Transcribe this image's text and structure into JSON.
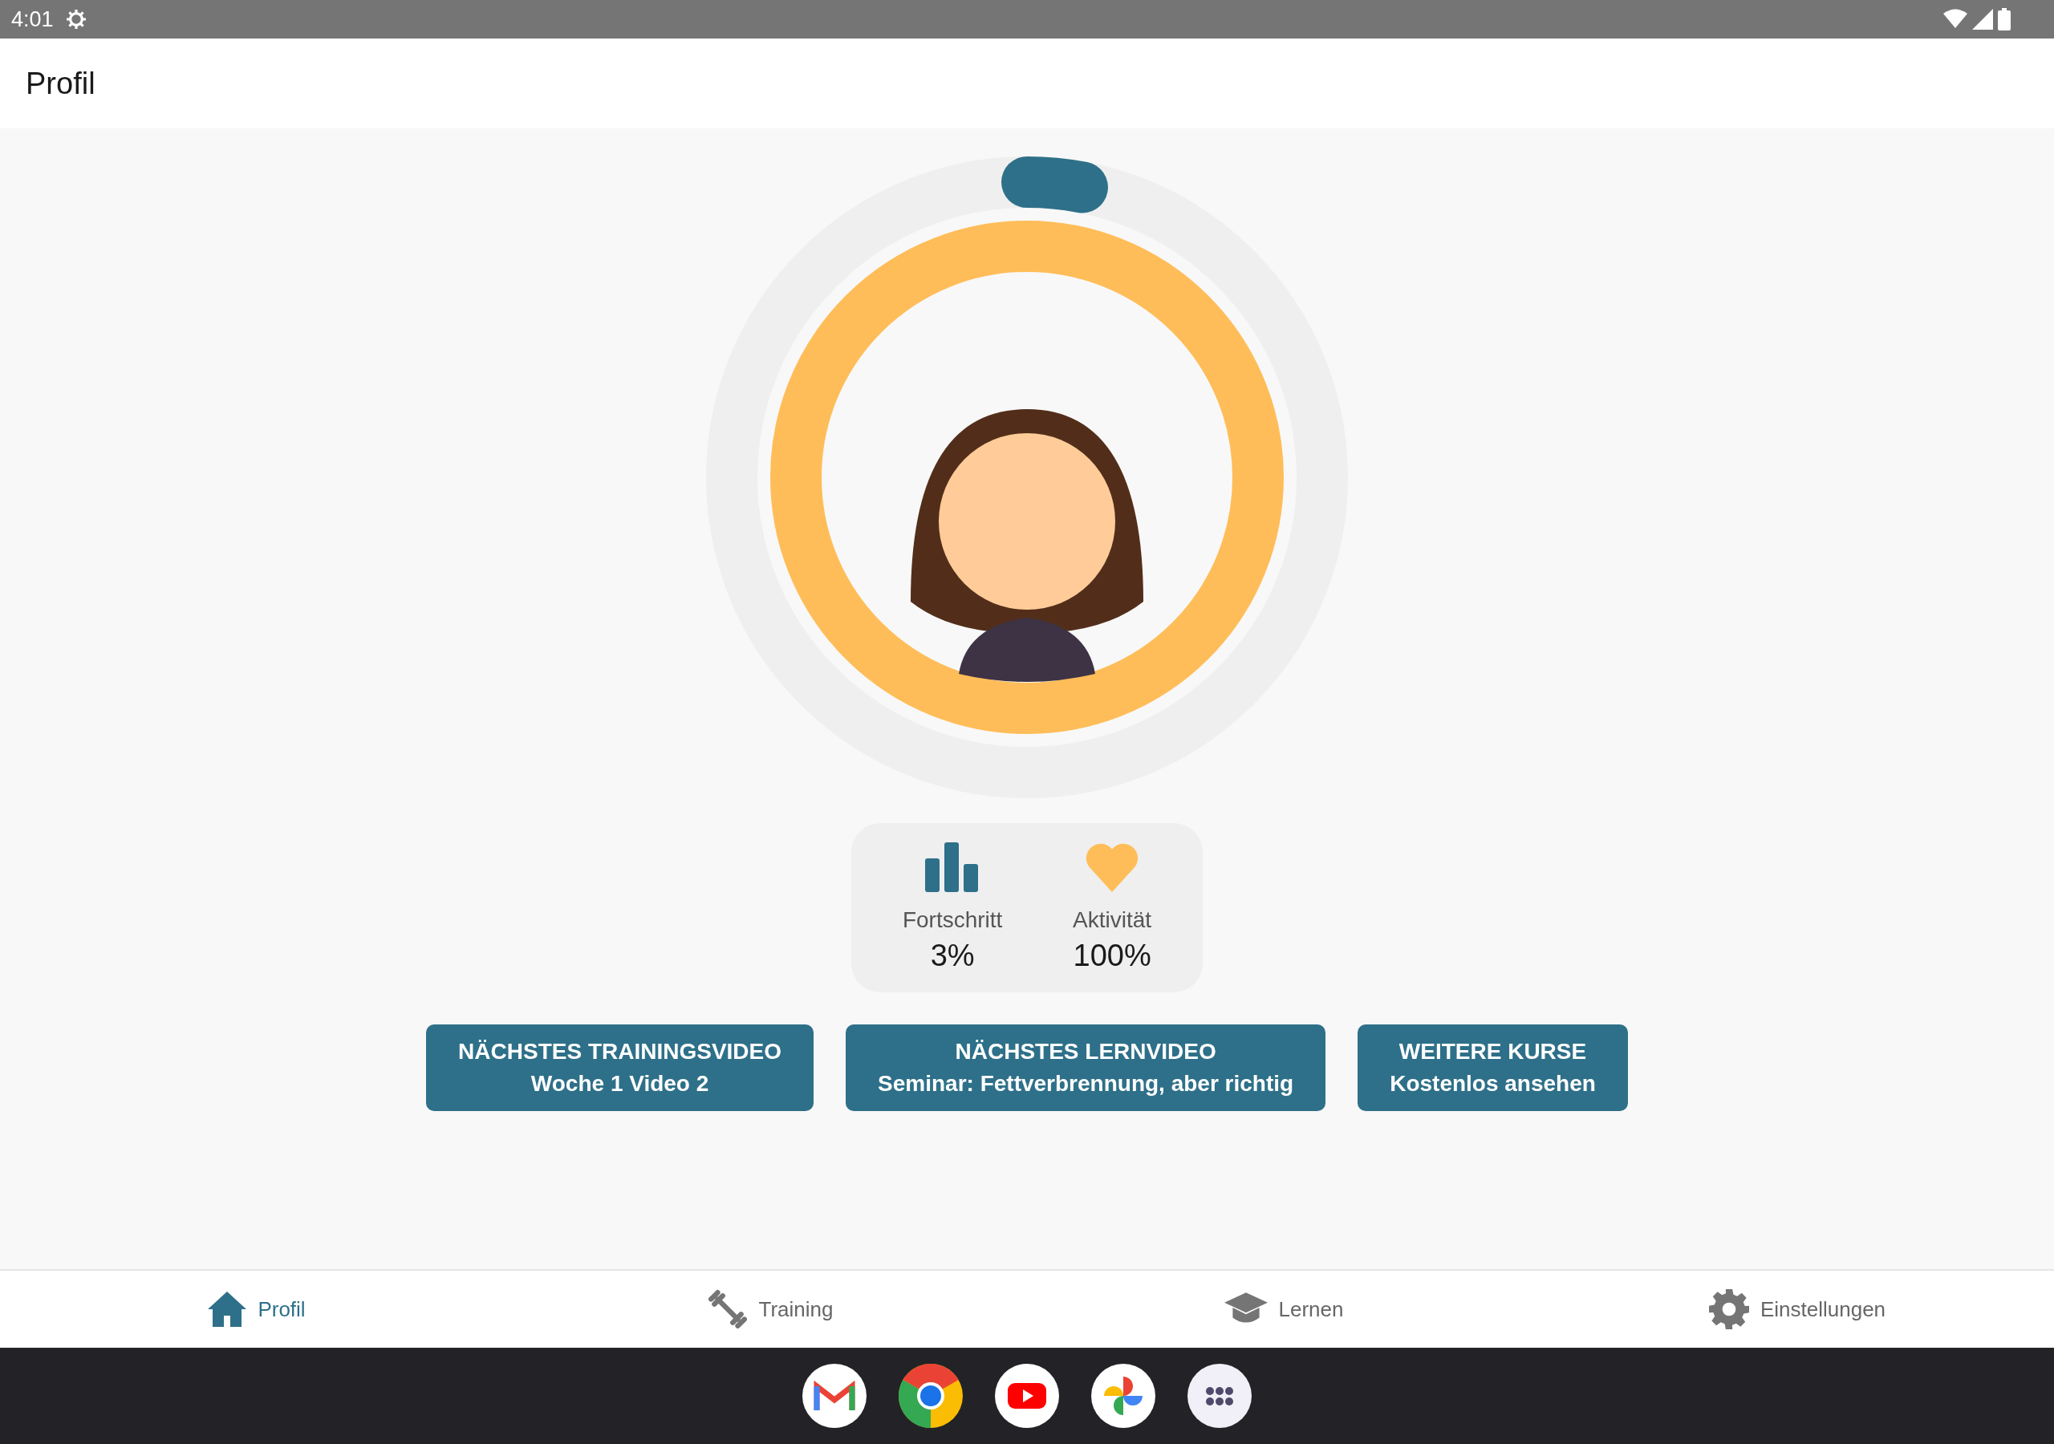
{
  "status_bar": {
    "time": "4:01"
  },
  "app_bar": {
    "title": "Profil"
  },
  "stats": [
    {
      "kind": "progress",
      "label": "Fortschritt",
      "value": "3%",
      "level": 0.03
    },
    {
      "kind": "activity",
      "label": "Aktivität",
      "value": "100%",
      "level": 1
    }
  ],
  "buttons": [
    {
      "title": "NÄCHSTES TRAININGSVIDEO",
      "subtitle": "Woche 1 Video 2"
    },
    {
      "title": "NÄCHSTES LERNVIDEO",
      "subtitle": "Seminar: Fettverbrennung, aber richtig"
    },
    {
      "title": "WEITERE KURSE",
      "subtitle": "Kostenlos ansehen"
    }
  ],
  "bottom_nav": [
    {
      "kind": "home",
      "label": "Profil",
      "selected": true
    },
    {
      "kind": "training",
      "label": "Training",
      "selected": false
    },
    {
      "kind": "learn",
      "label": "Lernen",
      "selected": false
    },
    {
      "kind": "settings",
      "label": "Einstellungen",
      "selected": false
    }
  ]
}
